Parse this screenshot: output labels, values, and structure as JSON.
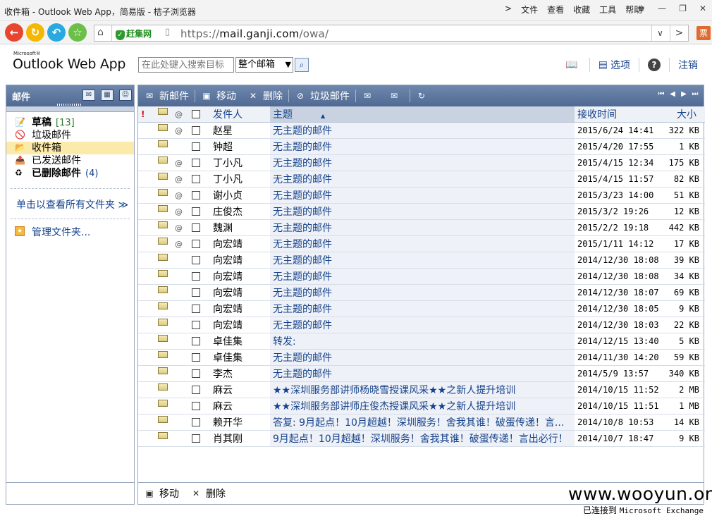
{
  "browser": {
    "window_title": "收件箱 - Outlook Web App，简易版 - 桔子浏览器",
    "menus": [
      "文件",
      "查看",
      "收藏",
      "工具",
      "帮助"
    ],
    "safe_badge": "赶集网",
    "url_prefix": "https://",
    "url_domain": "mail.ganji.com",
    "url_path": "/owa/",
    "ticket_label": "票"
  },
  "owa": {
    "logo_small": "Microsoft®",
    "logo": "Outlook Web App",
    "search_placeholder": "在此处键入搜索目标",
    "search_scope": "整个邮箱",
    "options_label": "选项",
    "logout_label": "注销"
  },
  "left": {
    "header": "邮件",
    "folders": [
      {
        "name": "草稿",
        "count": "[13]",
        "icon": "drafts-icon",
        "bold": true,
        "selected": false
      },
      {
        "name": "垃圾邮件",
        "count": "",
        "icon": "junk-icon",
        "bold": false,
        "selected": false
      },
      {
        "name": "收件箱",
        "count": "",
        "icon": "inbox-icon",
        "bold": false,
        "selected": true
      },
      {
        "name": "已发送邮件",
        "count": "",
        "icon": "sent-icon",
        "bold": false,
        "selected": false
      },
      {
        "name": "已删除邮件",
        "count": "(4)",
        "icon": "deleted-icon",
        "bold": true,
        "selected": false
      }
    ],
    "view_all": "单击以查看所有文件夹 ≫",
    "manage": "管理文件夹..."
  },
  "toolbar": {
    "new_mail": "新邮件",
    "move": "移动",
    "delete": "删除",
    "junk": "垃圾邮件"
  },
  "columns": {
    "sender": "发件人",
    "subject": "主题",
    "received": "接收时间",
    "size": "大小"
  },
  "messages": [
    {
      "sender": "赵星",
      "subject": "无主题的邮件",
      "date": "2015/6/24 14:41",
      "size": "322 KB",
      "attach": true
    },
    {
      "sender": "钟超",
      "subject": "无主题的邮件",
      "date": "2015/4/20 17:55",
      "size": "1 KB",
      "attach": false
    },
    {
      "sender": "丁小凡",
      "subject": "无主题的邮件",
      "date": "2015/4/15 12:34",
      "size": "175 KB",
      "attach": true
    },
    {
      "sender": "丁小凡",
      "subject": "无主题的邮件",
      "date": "2015/4/15 11:57",
      "size": "82 KB",
      "attach": true
    },
    {
      "sender": "谢小贞",
      "subject": "无主题的邮件",
      "date": "2015/3/23 14:00",
      "size": "51 KB",
      "attach": true
    },
    {
      "sender": "庄俊杰",
      "subject": "无主题的邮件",
      "date": "2015/3/2 19:26",
      "size": "12 KB",
      "attach": true
    },
    {
      "sender": "魏渊",
      "subject": "无主题的邮件",
      "date": "2015/2/2 19:18",
      "size": "442 KB",
      "attach": true
    },
    {
      "sender": "向宏靖",
      "subject": "无主题的邮件",
      "date": "2015/1/11 14:12",
      "size": "17 KB",
      "attach": true
    },
    {
      "sender": "向宏靖",
      "subject": "无主题的邮件",
      "date": "2014/12/30 18:08",
      "size": "39 KB",
      "attach": false
    },
    {
      "sender": "向宏靖",
      "subject": "无主题的邮件",
      "date": "2014/12/30 18:08",
      "size": "34 KB",
      "attach": false
    },
    {
      "sender": "向宏靖",
      "subject": "无主题的邮件",
      "date": "2014/12/30 18:07",
      "size": "69 KB",
      "attach": false
    },
    {
      "sender": "向宏靖",
      "subject": "无主题的邮件",
      "date": "2014/12/30 18:05",
      "size": "9 KB",
      "attach": false
    },
    {
      "sender": "向宏靖",
      "subject": "无主题的邮件",
      "date": "2014/12/30 18:03",
      "size": "22 KB",
      "attach": false
    },
    {
      "sender": "卓佳集",
      "subject": "转发:",
      "date": "2014/12/15 13:40",
      "size": "5 KB",
      "attach": false
    },
    {
      "sender": "卓佳集",
      "subject": "无主题的邮件",
      "date": "2014/11/30 14:20",
      "size": "59 KB",
      "attach": false
    },
    {
      "sender": "李杰",
      "subject": "无主题的邮件",
      "date": "2014/5/9 13:57",
      "size": "340 KB",
      "attach": false
    },
    {
      "sender": "麻云",
      "subject": "★★深圳服务部讲师杨晓雪授课风采★★之新人提升培训",
      "date": "2014/10/15 11:52",
      "size": "2 MB",
      "attach": false
    },
    {
      "sender": "麻云",
      "subject": "★★深圳服务部讲师庄俊杰授课风采★★之新人提升培训",
      "date": "2014/10/15 11:51",
      "size": "1 MB",
      "attach": false
    },
    {
      "sender": "赖开华",
      "subject": "答复: 9月起点！10月超越！深圳服务！舍我其谁！破蛋传递！言...",
      "date": "2014/10/8 10:53",
      "size": "14 KB",
      "attach": false
    },
    {
      "sender": "肖其刚",
      "subject": "9月起点！10月超越！深圳服务！舍我其谁！破蛋传递！言出必行！",
      "date": "2014/10/7 18:47",
      "size": "9 KB",
      "attach": false
    }
  ],
  "bottom": {
    "move": "移动",
    "delete": "删除"
  },
  "watermark": "www.wooyun.org",
  "status": {
    "prefix": "已连接到",
    "server": "Microsoft Exchange"
  }
}
